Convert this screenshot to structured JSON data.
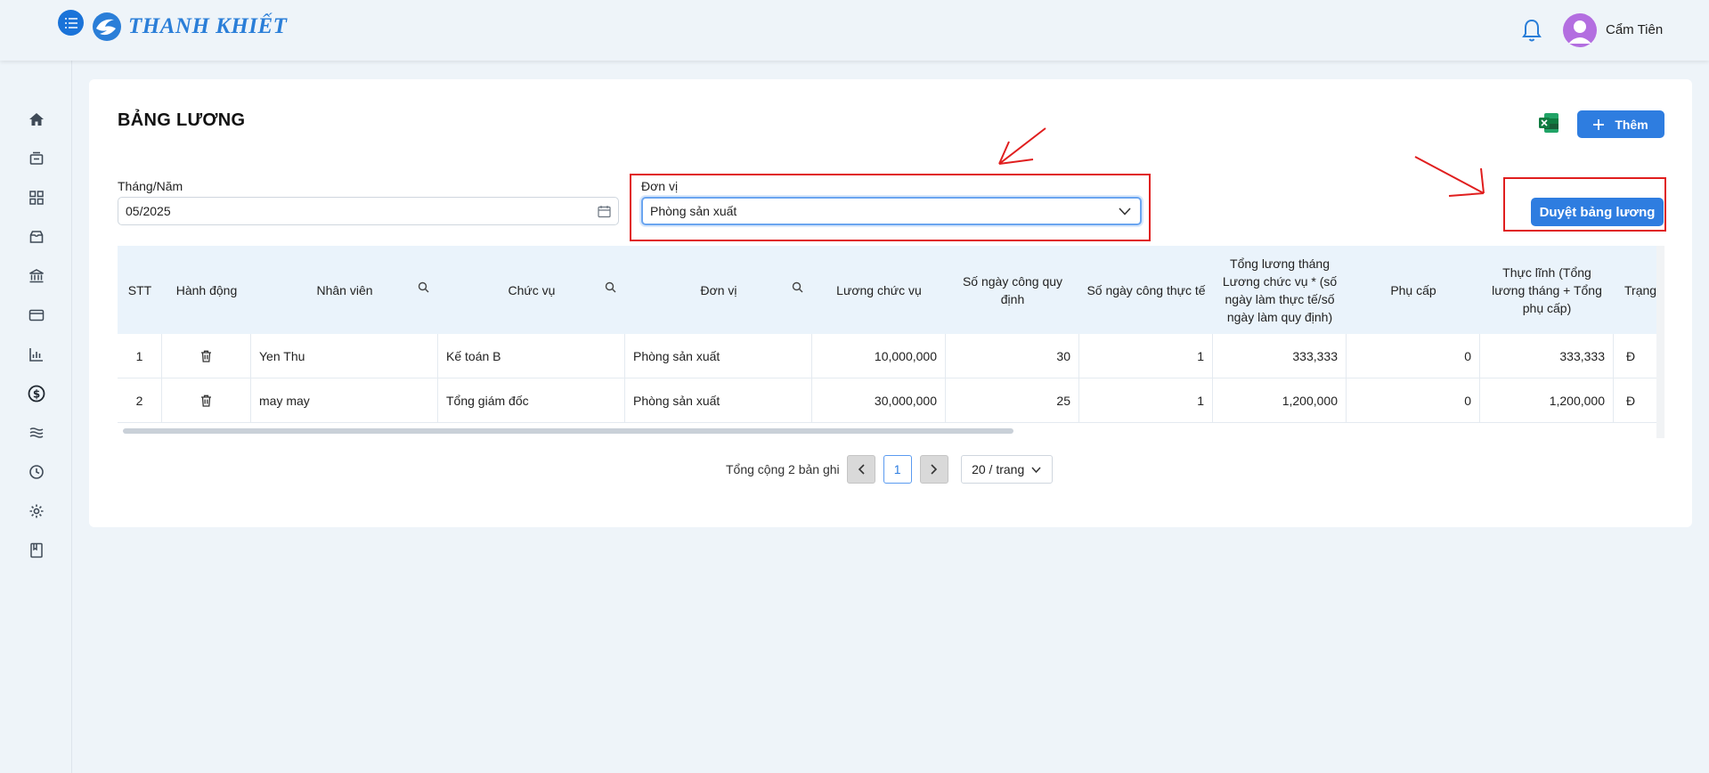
{
  "header": {
    "brand": "THANH KHIẾT",
    "user_name": "Cẩm Tiên"
  },
  "sidebar": {
    "icons": [
      "home-icon",
      "inbox-icon",
      "grid-icon",
      "box-icon",
      "bank-icon",
      "card-icon",
      "chart-icon",
      "dollar-icon",
      "layers-icon",
      "clock-icon",
      "gear-icon",
      "book-icon"
    ]
  },
  "page": {
    "title": "BẢNG LƯƠNG",
    "add_label": "Thêm",
    "approve_label": "Duyệt bảng lương"
  },
  "filters": {
    "month_label": "Tháng/Năm",
    "month_value": "05/2025",
    "unit_label": "Đơn vị",
    "unit_value": "Phòng sản xuất"
  },
  "table": {
    "headers": {
      "stt": "STT",
      "action": "Hành động",
      "employee": "Nhân viên",
      "position": "Chức vụ",
      "unit": "Đơn vị",
      "position_salary": "Lương chức vụ",
      "required_days": "Số ngày công quy định",
      "actual_days": "Số ngày công thực tế",
      "monthly_total": "Tổng lương tháng Lương chức vụ * (số ngày làm thực tế/số ngày làm quy định)",
      "allowance": "Phụ cấp",
      "net": "Thực lĩnh (Tổng lương tháng + Tổng phụ cấp)",
      "status": "Trạng thái"
    },
    "rows": [
      {
        "stt": "1",
        "employee": "Yen Thu",
        "position": "Kế toán B",
        "unit": "Phòng sản xuất",
        "position_salary": "10,000,000",
        "required_days": "30",
        "actual_days": "1",
        "monthly_total": "333,333",
        "allowance": "0",
        "net": "333,333",
        "status": "Đ"
      },
      {
        "stt": "2",
        "employee": "may may",
        "position": "Tổng giám đốc",
        "unit": "Phòng sản xuất",
        "position_salary": "30,000,000",
        "required_days": "25",
        "actual_days": "1",
        "monthly_total": "1,200,000",
        "allowance": "0",
        "net": "1,200,000",
        "status": "Đ"
      }
    ]
  },
  "pagination": {
    "total_text": "Tổng cộng 2 bản ghi",
    "current_page": "1",
    "page_size": "20 / trang"
  },
  "colors": {
    "primary": "#2e7de0",
    "annotation": "#e01e1e",
    "header_bg": "#eaf3fb"
  }
}
